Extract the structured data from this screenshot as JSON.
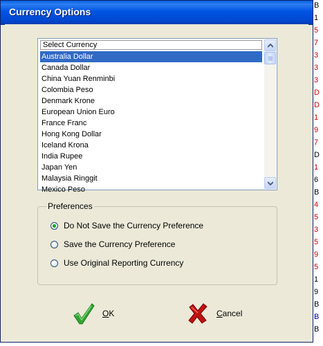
{
  "dialog": {
    "title": "Currency Options"
  },
  "currency_list": {
    "header": "Select Currency",
    "items": [
      "Australia Dollar",
      "Canada Dollar",
      "China Yuan Renminbi",
      "Colombia Peso",
      "Denmark Krone",
      "European Union Euro",
      "France Franc",
      "Hong Kong Dollar",
      "Iceland Krona",
      "India Rupee",
      "Japan Yen",
      "Malaysia Ringgit",
      "Mexico Peso"
    ],
    "selected": "Australia Dollar"
  },
  "preferences": {
    "legend": "Preferences",
    "options": [
      "Do Not Save the Currency Preference",
      "Save the Currency Preference",
      "Use Original Reporting Currency"
    ],
    "selected_index": 0
  },
  "buttons": {
    "ok_label": "OK",
    "ok_mnemonic": "O",
    "ok_rest": "K",
    "cancel_label": "Cancel",
    "cancel_mnemonic": "C",
    "cancel_rest": "ancel"
  },
  "background_strip": {
    "glyphs": [
      "B",
      "1",
      "5",
      "7",
      "3",
      "3",
      "3",
      "D",
      "D",
      "1",
      "9",
      "7",
      "D",
      "1",
      "6",
      "B",
      "4",
      "5",
      "3",
      "5",
      "9",
      "5",
      "1",
      "9",
      "B",
      "B",
      "B"
    ],
    "colors": {
      "red": "#d00000",
      "black": "#000000",
      "blue": "#0000c0"
    }
  },
  "colors": {
    "title_bar": "#0054e3",
    "selection": "#316ac5",
    "dialog_face": "#ece9d8",
    "ok_check": "#2fa52f",
    "cancel_x": "#c01010"
  }
}
